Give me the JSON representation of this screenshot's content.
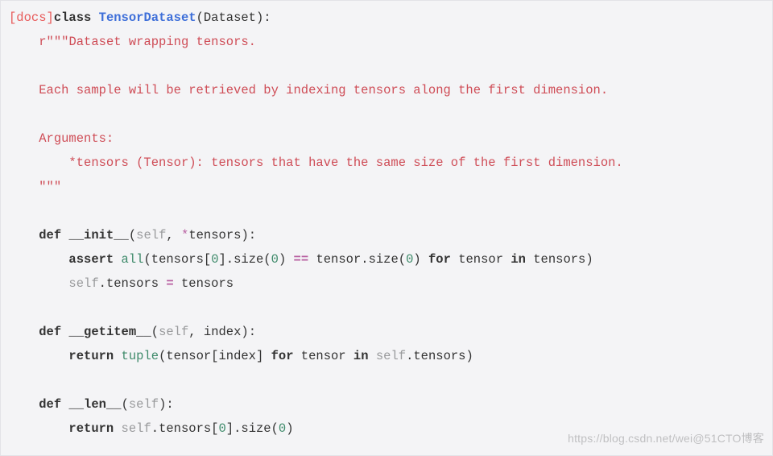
{
  "docs_link": "[docs]",
  "kw_class": "class",
  "class_name": "TensorDataset",
  "base_class": "Dataset",
  "docstring": {
    "open": "r\"\"\"",
    "line1": "Dataset wrapping tensors.",
    "line2": "Each sample will be retrieved by indexing tensors along the first dimension.",
    "line3": "Arguments:",
    "line4": "*tensors (Tensor): tensors that have the same size of the first dimension.",
    "close": "\"\"\""
  },
  "kw_def": "def",
  "init": {
    "name": "__init__",
    "params_self": "self",
    "params_rest": "*tensors",
    "assert_kw": "assert",
    "all_kw": "all",
    "expr_left": "tensors[",
    "zero": "0",
    "expr_mid1": "].size(",
    "eq": "==",
    "expr_mid2": " tensor.size(",
    "for_kw": "for",
    "tensor_var": " tensor ",
    "in_kw": "in",
    "tensors_var": " tensors)",
    "assign_left": ".tensors ",
    "equals": "=",
    "assign_right": " tensors"
  },
  "getitem": {
    "name": "__getitem__",
    "params_self": "self",
    "params_rest": "index",
    "return_kw": "return",
    "tuple_kw": "tuple",
    "expr1": "(tensor[index] ",
    "for_kw": "for",
    "tensor_var": " tensor ",
    "in_kw": "in",
    "self_tensors": ".tensors)"
  },
  "lenfn": {
    "name": "__len__",
    "params_self": "self",
    "return_kw": "return",
    "expr1": ".tensors[",
    "zero": "0",
    "expr2": "].size(",
    "expr3": ")"
  },
  "watermark_left": "https://blog.csdn.net/wei",
  "watermark_right": "@51CTO博客"
}
